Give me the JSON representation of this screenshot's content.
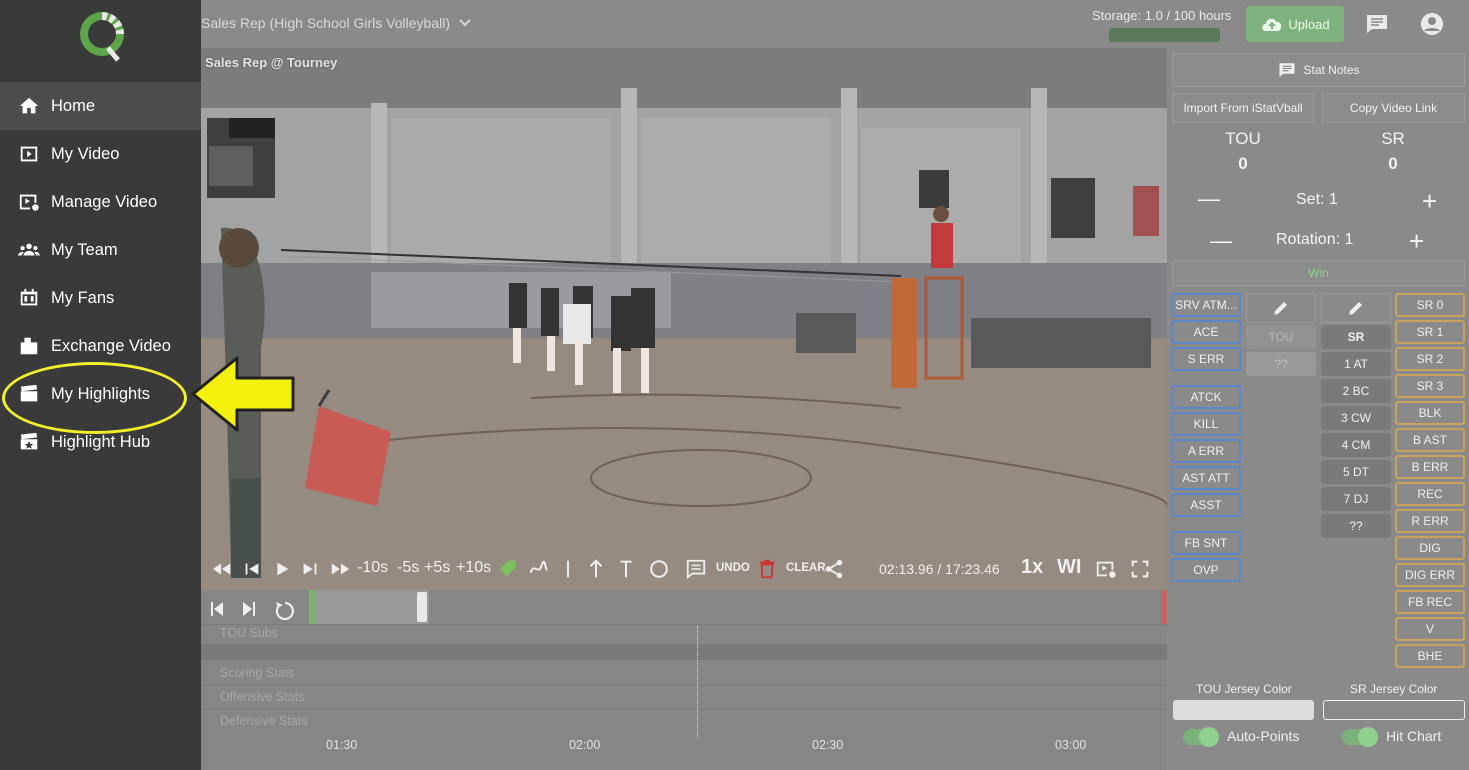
{
  "sidebar": {
    "items": [
      {
        "label": "Home",
        "icon": "home-icon",
        "active": true
      },
      {
        "label": "My Video",
        "icon": "video-icon"
      },
      {
        "label": "Manage Video",
        "icon": "manage-video-icon"
      },
      {
        "label": "My Team",
        "icon": "team-icon"
      },
      {
        "label": "My Fans",
        "icon": "scoreboard-icon"
      },
      {
        "label": "Exchange Video",
        "icon": "exchange-icon"
      },
      {
        "label": "My Highlights",
        "icon": "clapperboard-icon"
      },
      {
        "label": "Highlight Hub",
        "icon": "highlight-hub-icon"
      }
    ],
    "callout_color": "#f1f12a"
  },
  "topbar": {
    "title": "Sales Rep (High School Girls Volleyball)",
    "storage": "Storage: 1.0 / 100 hours",
    "upload": "Upload"
  },
  "video": {
    "label": "Sales Rep @ Tourney",
    "skip_back_10": "-10s",
    "skip_back_5": "-5s",
    "skip_fwd_5": "+5s",
    "skip_fwd_10": "+10s",
    "undo": "UNDO",
    "clear": "CLEAR",
    "time": "02:13.96 / 17:23.46",
    "speed": "1x",
    "wi": "WI"
  },
  "timeline": {
    "rows": [
      "TOU Subs",
      "Scoring Stats",
      "Offensive Stats",
      "Defensive Stats"
    ],
    "ticks": [
      "01:30",
      "02:00",
      "02:30",
      "03:00"
    ]
  },
  "panel": {
    "stat_notes": "Stat Notes",
    "import": "Import From iStatVball",
    "copy_link": "Copy Video Link",
    "team_left": "TOU",
    "team_right": "SR",
    "score_left": "0",
    "score_right": "0",
    "set": "Set: 1",
    "rotation": "Rotation: 1",
    "win": "Win",
    "blue_stats_a": [
      "SRV ATM...",
      "ACE",
      "S ERR"
    ],
    "blue_stats_b": [
      "ATCK",
      "KILL",
      "A ERR",
      "AST ATT",
      "ASST"
    ],
    "blue_stats_c": [
      "FB SNT",
      "OVP"
    ],
    "tou_col": [
      "TOU",
      "??"
    ],
    "sr_col": [
      "SR",
      "1 AT",
      "2 BC",
      "3 CW",
      "4 CM",
      "5 DT",
      "7 DJ",
      "??"
    ],
    "orange_stats": [
      "SR 0",
      "SR 1",
      "SR 2",
      "SR 3",
      "BLK",
      "B AST",
      "B ERR",
      "REC",
      "R ERR",
      "DIG",
      "DIG ERR",
      "FB REC",
      "V",
      "BHE"
    ],
    "tou_jersey": "TOU Jersey Color",
    "sr_jersey": "SR Jersey Color",
    "auto_points": "Auto-Points",
    "hit_chart": "Hit Chart"
  }
}
